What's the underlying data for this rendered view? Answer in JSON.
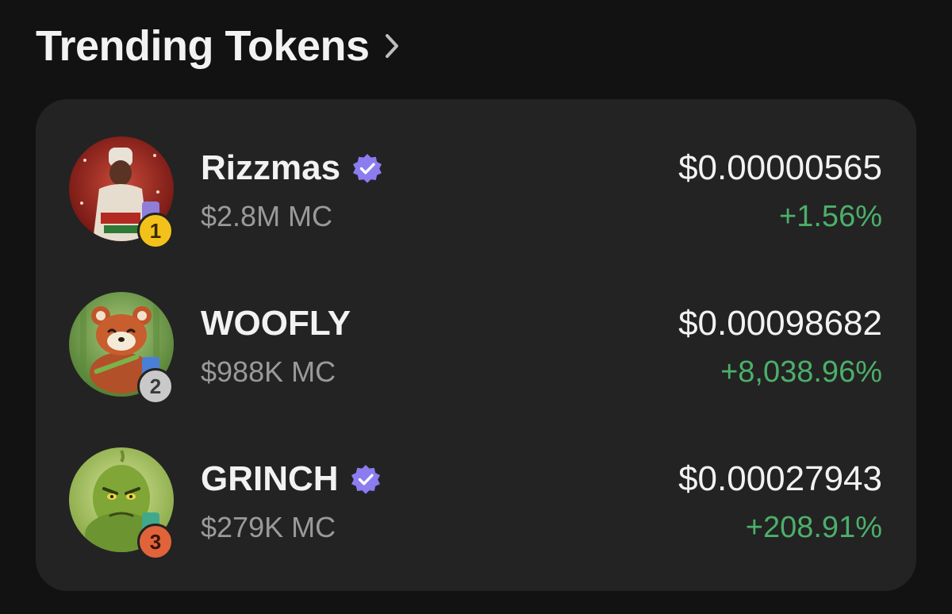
{
  "header": {
    "title": "Trending Tokens",
    "chevron_icon": "chevron-right-icon"
  },
  "tokens": [
    {
      "rank": "1",
      "name": "Rizzmas",
      "verified": true,
      "market_cap": "$2.8M MC",
      "price": "$0.00000565",
      "change": "+1.56%",
      "rank_color": "#f2c21b",
      "ribbon_color": "#8f7fd8",
      "avatar_icon": "rizzmas-avatar-icon"
    },
    {
      "rank": "2",
      "name": "WOOFLY",
      "verified": false,
      "market_cap": "$988K MC",
      "price": "$0.00098682",
      "change": "+8,038.96%",
      "rank_color": "#c9c9c9",
      "ribbon_color": "#4a7fd8",
      "avatar_icon": "red-panda-avatar-icon"
    },
    {
      "rank": "3",
      "name": "GRINCH",
      "verified": true,
      "market_cap": "$279K MC",
      "price": "$0.00027943",
      "change": "+208.91%",
      "rank_color": "#e0633a",
      "ribbon_color": "#3fa98a",
      "avatar_icon": "grinch-avatar-icon"
    }
  ],
  "colors": {
    "background": "#121212",
    "card": "#232323",
    "positive": "#4caf6a",
    "verified": "#8b7cf0",
    "muted_text": "#9a9a9a"
  }
}
